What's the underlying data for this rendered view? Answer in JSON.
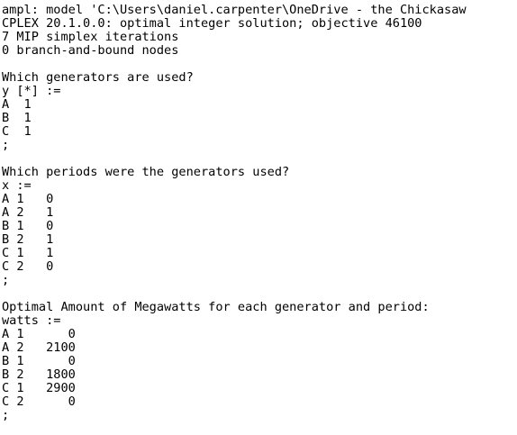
{
  "console": {
    "lines": [
      "ampl: model 'C:\\Users\\daniel.carpenter\\OneDrive - the Chickasaw",
      "CPLEX 20.1.0.0: optimal integer solution; objective 46100",
      "7 MIP simplex iterations",
      "0 branch-and-bound nodes",
      "",
      "Which generators are used?",
      "y [*] :=",
      "A  1",
      "B  1",
      "C  1",
      ";",
      "",
      "Which periods were the generators used?",
      "x :=",
      "A 1   0",
      "A 2   1",
      "B 1   0",
      "B 2   1",
      "C 1   1",
      "C 2   0",
      ";",
      "",
      "Optimal Amount of Megawatts for each generator and period:",
      "watts :=",
      "A 1      0",
      "A 2   2100",
      "B 1      0",
      "B 2   1800",
      "C 1   2900",
      "C 2      0",
      ";"
    ]
  }
}
